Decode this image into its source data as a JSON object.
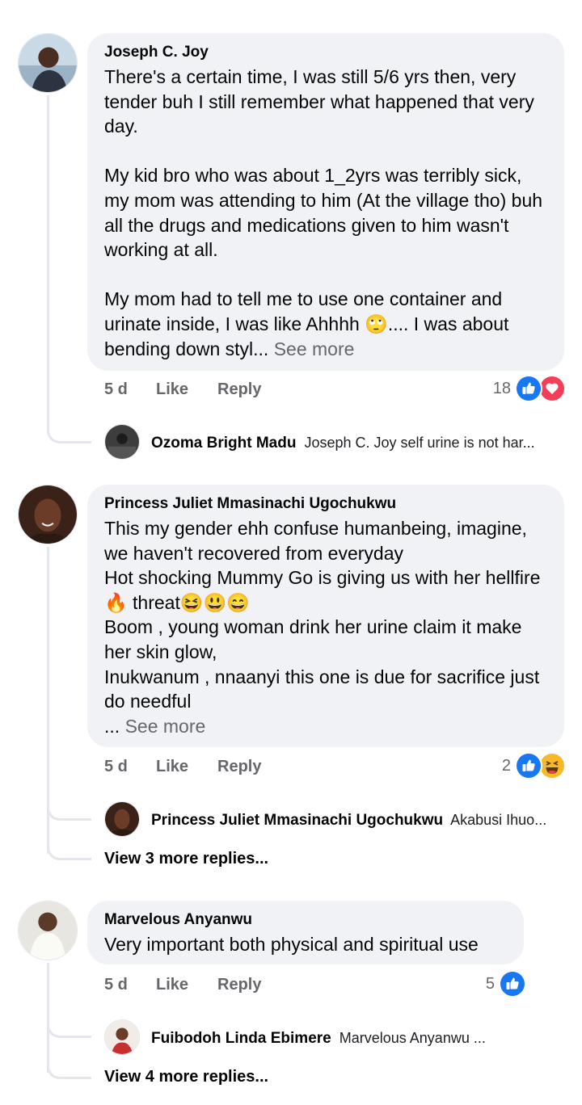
{
  "comments": [
    {
      "author": "Joseph C. Joy",
      "text": "There's a certain time, I was still 5/6 yrs then, very tender buh I still remember what happened that very day.\n\nMy kid bro who was about 1_2yrs was terribly sick, my mom was attending to him (At the village tho) buh all the drugs and medications given to him wasn't working at all.\n\nMy mom had to tell me to use one container and urinate inside, I was like Ahhhh 🙄.... I was about bending down styl...",
      "see_more": "See more",
      "time": "5 d",
      "like": "Like",
      "reply": "Reply",
      "reaction_count": "18",
      "reactions": [
        "like-icon",
        "love-icon"
      ],
      "replies": [
        {
          "author": "Ozoma Bright Madu",
          "text": "Joseph C. Joy self urine is not har..."
        }
      ]
    },
    {
      "author": "Princess Juliet Mmasinachi Ugochukwu",
      "text": "This my gender ehh confuse humanbeing, imagine, we haven't recovered from everyday\nHot shocking Mummy Go is giving us with her hellfire 🔥 threat😆😃😄\nBoom  , young woman drink her urine claim it make her skin glow,\nInukwanum , nnaanyi  this one is due for sacrifice just do needful\n...",
      "see_more": "See more",
      "time": "5 d",
      "like": "Like",
      "reply": "Reply",
      "reaction_count": "2",
      "reactions": [
        "like-icon",
        "haha-icon"
      ],
      "replies": [
        {
          "author": "Princess Juliet Mmasinachi Ugochukwu",
          "text": "Akabusi Ihuo..."
        }
      ],
      "view_more": "View 3 more replies..."
    },
    {
      "author": "Marvelous Anyanwu",
      "text": "Very important both physical and spiritual use",
      "time": "5 d",
      "like": "Like",
      "reply": "Reply",
      "reaction_count": "5",
      "reactions": [
        "like-icon"
      ],
      "replies": [
        {
          "author": "Fuibodoh Linda Ebimere",
          "text": "Marvelous Anyanwu ..."
        }
      ],
      "view_more": "View 4 more replies..."
    }
  ],
  "colors": {
    "like": "#1877f2",
    "love": "#f33e58",
    "haha": "#f7b928",
    "bubble": "#f0f2f5",
    "muted": "#65676b"
  }
}
